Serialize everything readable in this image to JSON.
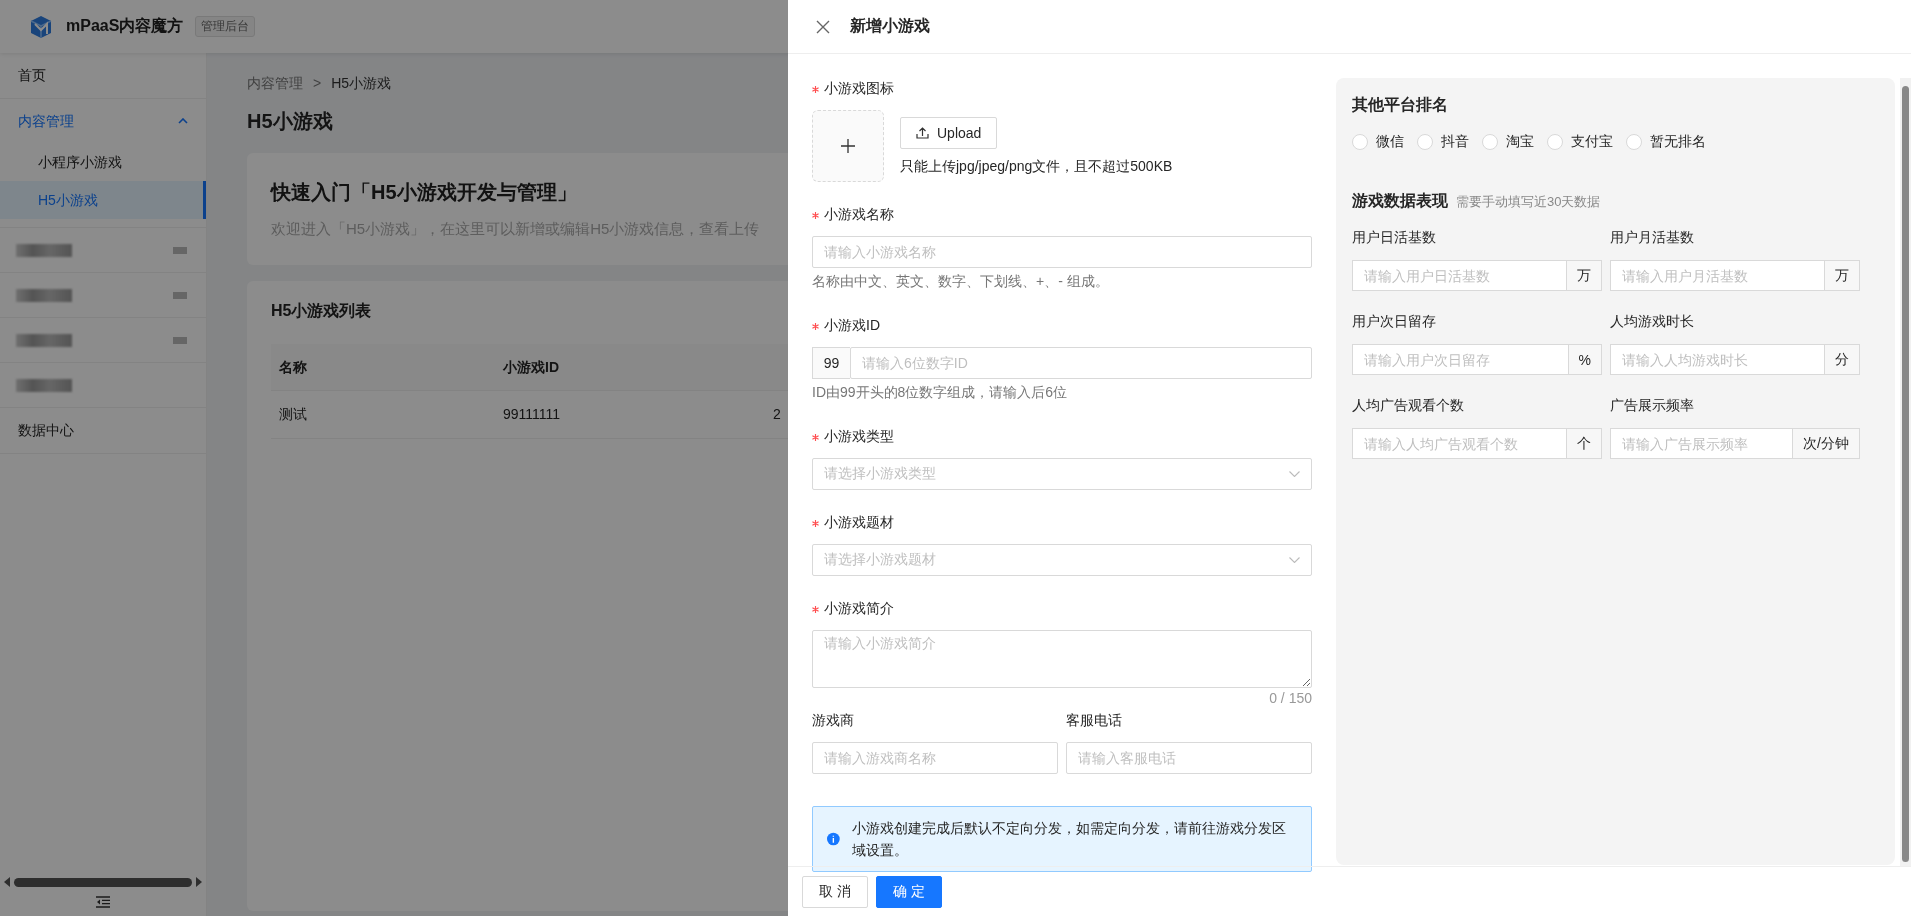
{
  "app": {
    "title": "mPaaS内容魔方",
    "badge": "管理后台"
  },
  "sidebar": {
    "items": [
      {
        "kind": "item",
        "label": "首页",
        "selected": false
      },
      {
        "kind": "group",
        "label": "内容管理",
        "expanded": true,
        "children": [
          {
            "label": "小程序小游戏",
            "selected": false
          },
          {
            "label": "H5小游戏",
            "selected": true
          }
        ]
      },
      {
        "kind": "redacted",
        "short": false
      },
      {
        "kind": "redacted",
        "short": false
      },
      {
        "kind": "redacted",
        "short": false
      },
      {
        "kind": "redacted",
        "short": true
      },
      {
        "kind": "item",
        "label": "数据中心",
        "selected": false
      }
    ]
  },
  "breadcrumb": {
    "items": [
      "内容管理",
      "H5小游戏"
    ],
    "separator": ">"
  },
  "page_title": "H5小游戏",
  "intro": {
    "title": "快速入门「H5小游戏开发与管理」",
    "description": "欢迎进入「H5小游戏」，在这里可以新增或编辑H5小游戏信息，查看上传"
  },
  "table": {
    "title": "H5小游戏列表",
    "columns": [
      "名称",
      "小游戏ID"
    ],
    "rows": [
      [
        "测试",
        "99111111",
        "2"
      ]
    ]
  },
  "drawer": {
    "title": "新增小游戏",
    "fields": [
      {
        "kind": "upload",
        "label": "小游戏图标",
        "required": true,
        "button": "Upload",
        "hint": "只能上传jpg/jpeg/png文件，且不超过500KB"
      },
      {
        "kind": "text",
        "label": "小游戏名称",
        "required": true,
        "placeholder": "请输入小游戏名称",
        "hint": "名称由中文、英文、数字、下划线、+、- 组成。"
      },
      {
        "kind": "prefixed",
        "label": "小游戏ID",
        "required": true,
        "prefix": "99",
        "placeholder": "请输入6位数字ID",
        "hint": "ID由99开头的8位数字组成，请输入后6位"
      },
      {
        "kind": "select",
        "label": "小游戏类型",
        "required": true,
        "placeholder": "请选择小游戏类型"
      },
      {
        "kind": "select",
        "label": "小游戏题材",
        "required": true,
        "placeholder": "请选择小游戏题材"
      },
      {
        "kind": "textarea",
        "label": "小游戏简介",
        "required": true,
        "placeholder": "请输入小游戏简介",
        "counter": "0 / 150"
      },
      {
        "kind": "pair",
        "fields": [
          {
            "label": "游戏商",
            "placeholder": "请输入游戏商名称"
          },
          {
            "label": "客服电话",
            "placeholder": "请输入客服电话"
          }
        ]
      }
    ],
    "alert": "小游戏创建完成后默认不定向分发，如需定向分发，请前往游戏分发区域设置。",
    "ranking": {
      "title": "其他平台排名",
      "options": [
        {
          "label": "微信",
          "selected": false
        },
        {
          "label": "抖音",
          "selected": false
        },
        {
          "label": "淘宝",
          "selected": false
        },
        {
          "label": "支付宝",
          "selected": false
        },
        {
          "label": "暂无排名",
          "selected": false
        }
      ]
    },
    "metrics": {
      "title": "游戏数据表现",
      "note": "需要手动填写近30天数据",
      "fields": [
        {
          "label": "用户日活基数",
          "placeholder": "请输入用户日活基数",
          "unit": "万"
        },
        {
          "label": "用户月活基数",
          "placeholder": "请输入用户月活基数",
          "unit": "万"
        },
        {
          "label": "用户次日留存",
          "placeholder": "请输入用户次日留存",
          "unit": "%"
        },
        {
          "label": "人均游戏时长",
          "placeholder": "请输入人均游戏时长",
          "unit": "分"
        },
        {
          "label": "人均广告观看个数",
          "placeholder": "请输入人均广告观看个数",
          "unit": "个"
        },
        {
          "label": "广告展示频率",
          "placeholder": "请输入广告展示频率",
          "unit": "次/分钟"
        }
      ]
    },
    "buttons": [
      {
        "label": "取 消",
        "kind": "default"
      },
      {
        "label": "确 定",
        "kind": "primary"
      }
    ]
  }
}
